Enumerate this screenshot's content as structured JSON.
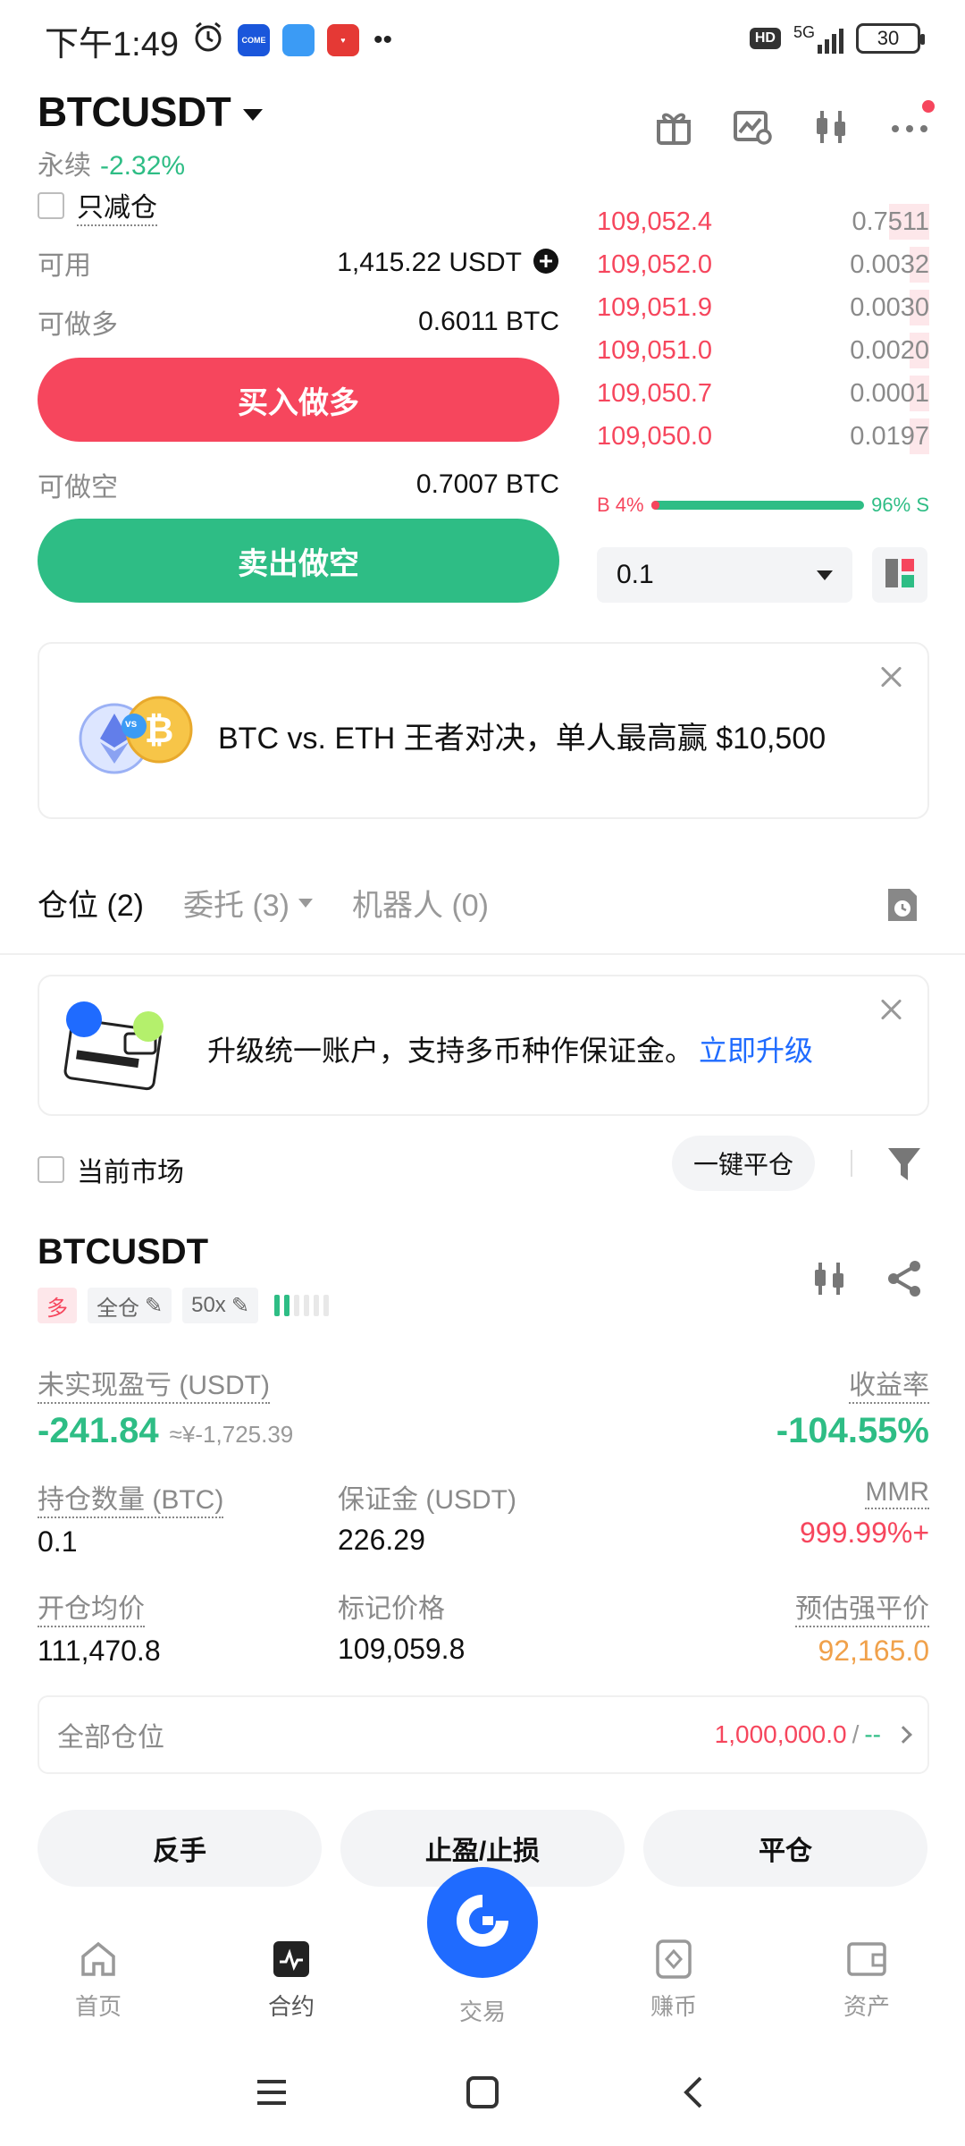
{
  "status": {
    "time": "下午1:49",
    "network": "5G",
    "hd": "HD",
    "battery": "30"
  },
  "header": {
    "pair": "BTCUSDT",
    "type": "永续",
    "change": "-2.32%"
  },
  "trade": {
    "reduce_only": "只减仓",
    "available_label": "可用",
    "available_value": "1,415.22 USDT",
    "can_long_label": "可做多",
    "can_long_value": "0.6011 BTC",
    "buy_button": "买入做多",
    "can_short_label": "可做空",
    "can_short_value": "0.7007 BTC",
    "sell_button": "卖出做空"
  },
  "orderbook": {
    "asks": [
      {
        "price": "109,052.4",
        "size": "0.7511",
        "depth": 0.12
      },
      {
        "price": "109,052.0",
        "size": "0.0032",
        "depth": 0.06
      },
      {
        "price": "109,051.9",
        "size": "0.0030",
        "depth": 0.06
      },
      {
        "price": "109,051.0",
        "size": "0.0020",
        "depth": 0.06
      },
      {
        "price": "109,050.7",
        "size": "0.0001",
        "depth": 0.06
      },
      {
        "price": "109,050.0",
        "size": "0.0197",
        "depth": 0.06
      }
    ],
    "buy_ratio_label": "B 4%",
    "sell_ratio_label": "96% S",
    "buy_ratio": 0.04,
    "qty_select": "0.1"
  },
  "promo": {
    "text": "BTC vs. ETH 王者对决，单人最高赢 $10,500",
    "badge": "vs"
  },
  "tabs": {
    "positions": "仓位 (2)",
    "orders": "委托 (3)",
    "bots": "机器人 (0)"
  },
  "upgrade_banner": {
    "text": "升级统一账户，支持多币种作保证金。",
    "link": "立即升级"
  },
  "filter": {
    "current_market": "当前市场",
    "close_all": "一键平仓"
  },
  "position": {
    "symbol": "BTCUSDT",
    "side": "多",
    "margin_mode": "全仓",
    "leverage": "50x",
    "pnl_label": "未实现盈亏 (USDT)",
    "pnl_value": "-241.84",
    "pnl_cny": "≈¥-1,725.39",
    "roe_label": "收益率",
    "roe_value": "-104.55%",
    "size_label": "持仓数量 (BTC)",
    "size_value": "0.1",
    "margin_label": "保证金 (USDT)",
    "margin_value": "226.29",
    "mmr_label": "MMR",
    "mmr_value": "999.99%+",
    "entry_label": "开仓均价",
    "entry_value": "111,470.8",
    "mark_label": "标记价格",
    "mark_value": "109,059.8",
    "liq_label": "预估强平价",
    "liq_value": "92,165.0",
    "all_positions_label": "全部仓位",
    "all_positions_value": "1,000,000.0",
    "all_positions_sep": "/",
    "all_positions_extra": "--",
    "reverse_button": "反手",
    "tpsl_button": "止盈/止损",
    "close_button": "平仓"
  },
  "bottom_nav": {
    "home": "首页",
    "futures": "合约",
    "trade": "交易",
    "earn": "赚币",
    "assets": "资产"
  },
  "colors": {
    "red": "#f6465d",
    "green": "#2ebd85",
    "blue": "#1f6bff",
    "orange": "#f0a14b"
  }
}
